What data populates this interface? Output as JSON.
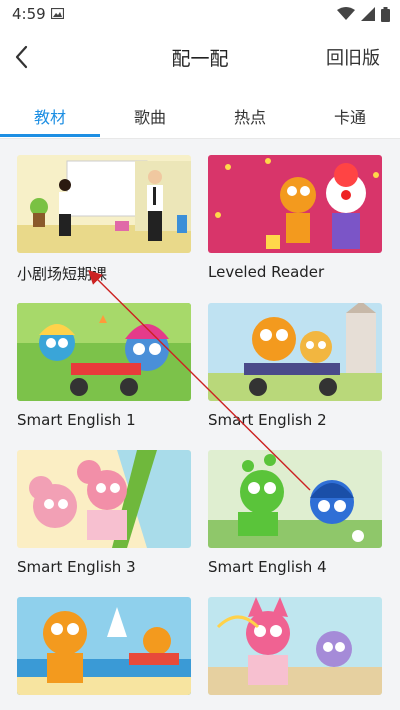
{
  "status_bar": {
    "time": "4:59",
    "icons": [
      "image-icon",
      "wifi-icon",
      "signal-icon",
      "battery-icon"
    ]
  },
  "header": {
    "title": "配一配",
    "right_action": "回旧版",
    "back_icon": "chevron-left-icon"
  },
  "tabs": [
    {
      "label": "教材",
      "active": true
    },
    {
      "label": "歌曲",
      "active": false
    },
    {
      "label": "热点",
      "active": false
    },
    {
      "label": "卡通",
      "active": false
    }
  ],
  "accent_color": "#1e8fe3",
  "cards": [
    {
      "label": "小剧场短期课"
    },
    {
      "label": "Leveled Reader"
    },
    {
      "label": "Smart English 1"
    },
    {
      "label": "Smart English 2"
    },
    {
      "label": "Smart English 3"
    },
    {
      "label": "Smart English 4"
    },
    {
      "label": ""
    },
    {
      "label": ""
    }
  ],
  "annotation_color": "#cc2222"
}
